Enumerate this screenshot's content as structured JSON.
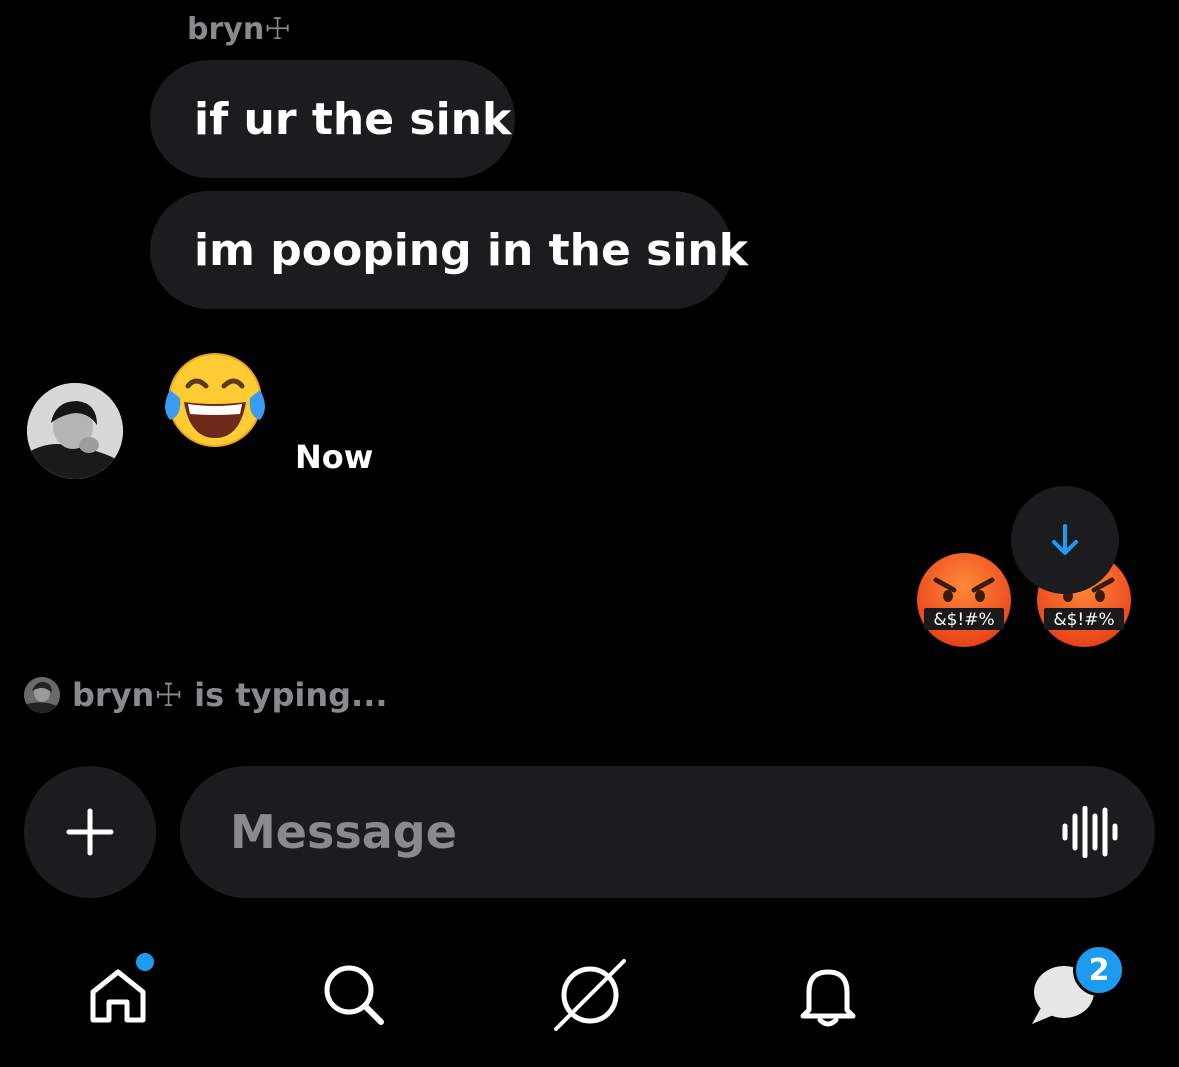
{
  "conversation": {
    "sender_name": "bryn☩",
    "messages": [
      {
        "text": "if ur the sink"
      },
      {
        "text": "im pooping in the sink"
      }
    ],
    "received_emoji": "face-with-tears-of-joy",
    "timestamp": "Now",
    "sent_emojis": [
      "face-with-symbols-on-mouth",
      "face-with-symbols-on-mouth"
    ],
    "angry_symbols": "&$!#%",
    "typing_indicator": "bryn☩ is typing..."
  },
  "composer": {
    "placeholder": "Message",
    "add_icon": "plus-icon",
    "voice_icon": "waveform-icon"
  },
  "tab_bar": {
    "items": [
      "home-icon",
      "search-icon",
      "explore-icon",
      "notifications-icon",
      "messages-icon"
    ],
    "messages_badge": "2"
  },
  "colors": {
    "background": "#000000",
    "bubble": "#1c1c1e",
    "accent": "#1d9bf0",
    "muted_text": "#8a8a8e"
  }
}
